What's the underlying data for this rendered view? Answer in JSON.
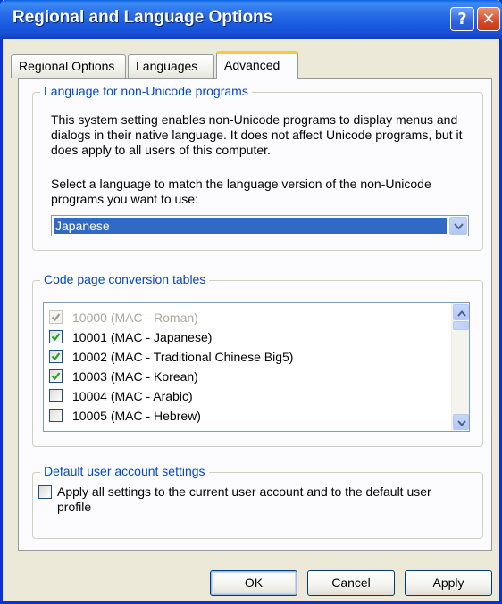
{
  "window": {
    "title": "Regional and Language Options",
    "help_glyph": "?",
    "close_glyph": "✕"
  },
  "tabs": [
    {
      "label": "Regional Options",
      "active": false
    },
    {
      "label": "Languages",
      "active": false
    },
    {
      "label": "Advanced",
      "active": true
    }
  ],
  "non_unicode": {
    "legend": "Language for non-Unicode programs",
    "description": "This system setting enables non-Unicode programs to display menus and dialogs in their native language. It does not affect Unicode programs, but it does apply to all users of this computer.",
    "select_prompt": "Select a language to match the language version of the non-Unicode programs you want to use:",
    "selected_language": "Japanese"
  },
  "code_pages": {
    "legend": "Code page conversion tables",
    "items": [
      {
        "label": "10000 (MAC - Roman)",
        "checked": true,
        "disabled": true
      },
      {
        "label": "10001 (MAC - Japanese)",
        "checked": true,
        "disabled": false
      },
      {
        "label": "10002 (MAC - Traditional Chinese Big5)",
        "checked": true,
        "disabled": false
      },
      {
        "label": "10003 (MAC - Korean)",
        "checked": true,
        "disabled": false
      },
      {
        "label": "10004 (MAC - Arabic)",
        "checked": false,
        "disabled": false
      },
      {
        "label": "10005 (MAC - Hebrew)",
        "checked": false,
        "disabled": false
      }
    ]
  },
  "default_account": {
    "legend": "Default user account settings",
    "checkbox_label": "Apply all settings to the current user account and to the default user profile",
    "checked": false
  },
  "buttons": {
    "ok": "OK",
    "cancel": "Cancel",
    "apply": "Apply"
  },
  "colors": {
    "title_bar": "#1a5ce0",
    "selection": "#316ac5",
    "group_legend": "#0046d5",
    "dialog_face": "#ece9d8"
  }
}
